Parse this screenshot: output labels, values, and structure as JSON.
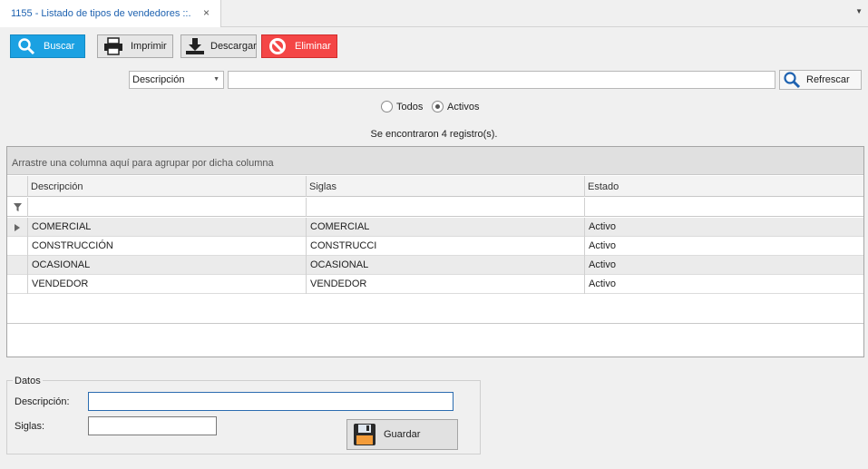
{
  "tab": {
    "title": "1155 - Listado de tipos de vendedores ::.",
    "close": "×",
    "menu": "▼"
  },
  "toolbar": {
    "buscar": "Buscar",
    "imprimir": "Imprimir",
    "descargar": "Descargar",
    "eliminar": "Eliminar"
  },
  "filter": {
    "field": "Descripción",
    "search_value": "",
    "refresh": "Refrescar"
  },
  "status_filter": {
    "todos": "Todos",
    "activos": "Activos",
    "selected": "Activos"
  },
  "result_count": "Se encontraron 4 registro(s).",
  "grid": {
    "group_hint": "Arrastre una columna aquí para agrupar por dicha columna",
    "columns": [
      "Descripción",
      "Siglas",
      "Estado"
    ],
    "rows": [
      {
        "descripcion": "COMERCIAL",
        "siglas": "COMERCIAL",
        "estado": "Activo"
      },
      {
        "descripcion": "CONSTRUCCIÓN",
        "siglas": "CONSTRUCCI",
        "estado": "Activo"
      },
      {
        "descripcion": "OCASIONAL",
        "siglas": "OCASIONAL",
        "estado": "Activo"
      },
      {
        "descripcion": "VENDEDOR",
        "siglas": "VENDEDOR",
        "estado": "Activo"
      }
    ]
  },
  "datos": {
    "legend": "Datos",
    "descripcion_label": "Descripción:",
    "descripcion_value": "",
    "siglas_label": "Siglas:",
    "siglas_value": "",
    "guardar": "Guardar"
  },
  "colors": {
    "buscar": "#1ba1e2",
    "eliminar": "#f44646",
    "tab_title": "#1e62b0"
  }
}
